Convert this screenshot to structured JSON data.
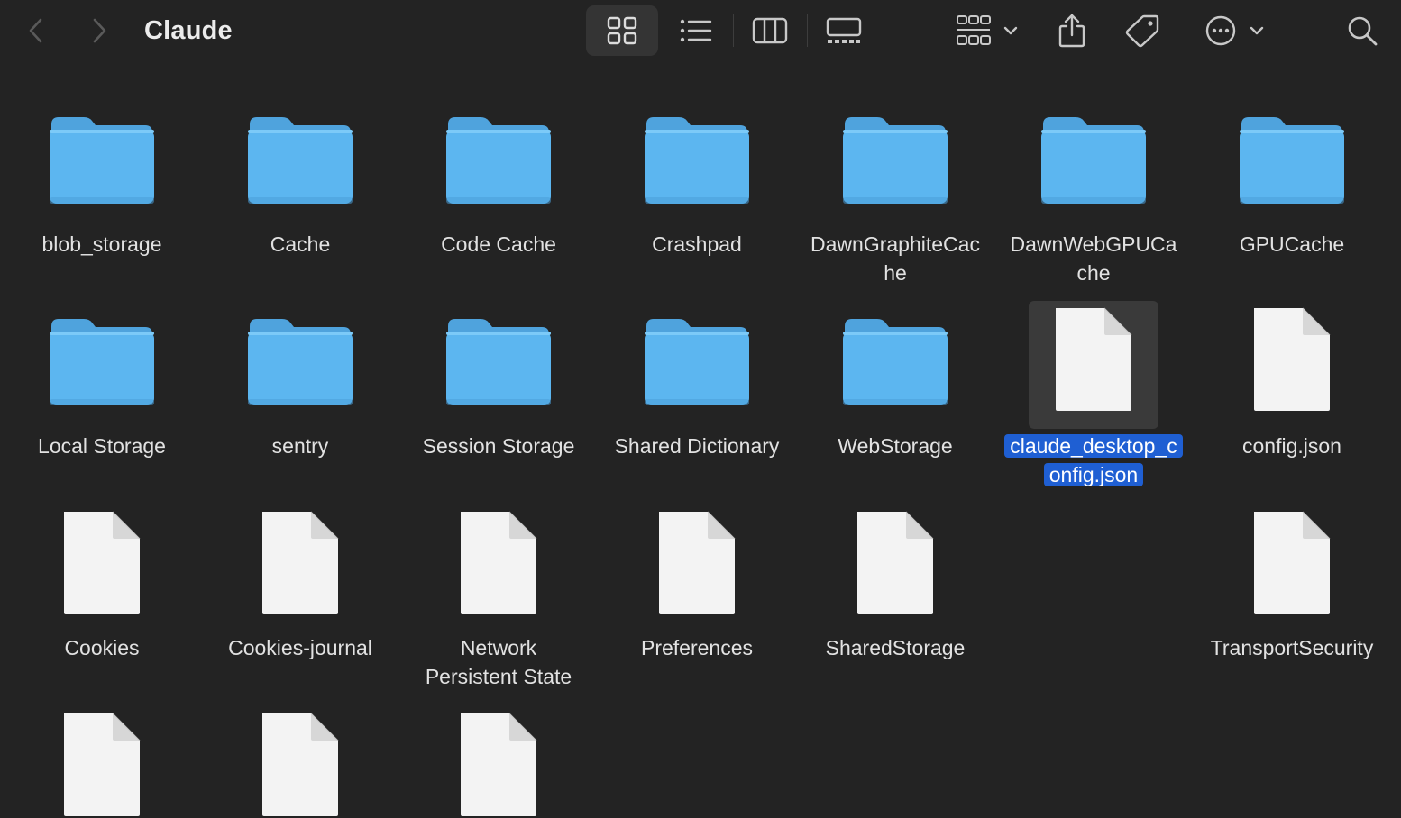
{
  "window": {
    "title": "Claude"
  },
  "toolbar": {
    "back_icon": "chevron-left-icon",
    "forward_icon": "chevron-right-icon",
    "view_icons": "grid-icon",
    "view_list": "list-icon",
    "view_columns": "columns-icon",
    "view_gallery": "gallery-icon",
    "group_icon": "group-by-icon",
    "share_icon": "share-icon",
    "tag_icon": "tag-icon",
    "more_icon": "ellipsis-circle-icon",
    "search_icon": "search-icon"
  },
  "colors": {
    "background": "#232323",
    "folder": "#5fb8f2",
    "selection": "#1f5fd3"
  },
  "items": [
    {
      "name": "blob_storage",
      "kind": "folder"
    },
    {
      "name": "Cache",
      "kind": "folder"
    },
    {
      "name": "Code Cache",
      "kind": "folder"
    },
    {
      "name": "Crashpad",
      "kind": "folder"
    },
    {
      "name": "DawnGraphiteCache",
      "line1": "DawnGraphiteCac",
      "line2": "he",
      "kind": "folder"
    },
    {
      "name": "DawnWebGPUCache",
      "line1": "DawnWebGPUCa",
      "line2": "che",
      "kind": "folder"
    },
    {
      "name": "GPUCache",
      "kind": "folder"
    },
    {
      "name": "Local Storage",
      "kind": "folder"
    },
    {
      "name": "sentry",
      "kind": "folder"
    },
    {
      "name": "Session Storage",
      "kind": "folder"
    },
    {
      "name": "Shared Dictionary",
      "kind": "folder"
    },
    {
      "name": "WebStorage",
      "kind": "folder"
    },
    {
      "name": "claude_desktop_config.json",
      "line1": "claude_desktop_c",
      "line2": "onfig.json",
      "kind": "file",
      "selected": true
    },
    {
      "name": "config.json",
      "kind": "file"
    },
    {
      "name": "Cookies",
      "kind": "file"
    },
    {
      "name": "Cookies-journal",
      "kind": "file"
    },
    {
      "name": "Network Persistent State",
      "line1": "Network",
      "line2": "Persistent State",
      "kind": "file"
    },
    {
      "name": "Preferences",
      "kind": "file"
    },
    {
      "name": "SharedStorage",
      "kind": "file"
    },
    {
      "name": "TransportSecurity",
      "kind": "file"
    }
  ]
}
